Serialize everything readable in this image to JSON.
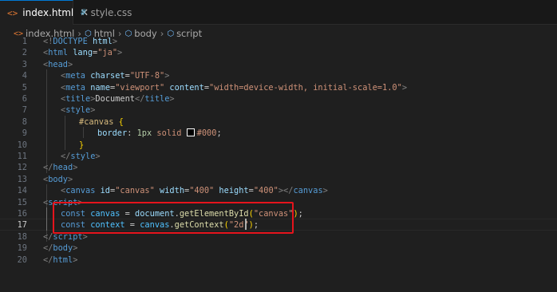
{
  "tabs": [
    {
      "icon": "<>",
      "label": "index.html",
      "close": "✕"
    },
    {
      "icon": "#",
      "label": "style.css"
    }
  ],
  "breadcrumb": {
    "file": "index.html",
    "items": [
      "html",
      "body",
      "script"
    ],
    "separator": "›"
  },
  "line_numbers": [
    "1",
    "2",
    "3",
    "4",
    "5",
    "6",
    "7",
    "8",
    "9",
    "10",
    "11",
    "12",
    "13",
    "14",
    "15",
    "16",
    "17",
    "18",
    "19",
    "20"
  ],
  "code": {
    "l1": {
      "p1": "<!",
      "tag": "DOCTYPE",
      "attr": " html",
      "p2": ">"
    },
    "l2": {
      "p1": "<",
      "tag": "html",
      "attr": " lang",
      "eq": "=",
      "val": "\"ja\"",
      "p2": ">"
    },
    "l3": {
      "p1": "<",
      "tag": "head",
      "p2": ">"
    },
    "l4": {
      "p1": "<",
      "tag": "meta",
      "attr": " charset",
      "eq": "=",
      "val": "\"UTF-8\"",
      "p2": ">"
    },
    "l5": {
      "p1": "<",
      "tag": "meta",
      "attr1": " name",
      "eq1": "=",
      "val1": "\"viewport\"",
      "attr2": " content",
      "eq2": "=",
      "val2": "\"width=device-width, initial-scale=1.0\"",
      "p2": ">"
    },
    "l6": {
      "p1": "<",
      "tag": "title",
      "p2": ">",
      "text": "Document",
      "p3": "</",
      "tag2": "title",
      "p4": ">"
    },
    "l7": {
      "p1": "<",
      "tag": "style",
      "p2": ">"
    },
    "l8": {
      "sel": "#canvas",
      "brace": " {"
    },
    "l9": {
      "prop": "border",
      "colon": ": ",
      "num": "1px",
      "rest": " solid ",
      "color": "#000",
      "semi": ";"
    },
    "l10": {
      "brace": "}"
    },
    "l11": {
      "p1": "</",
      "tag": "style",
      "p2": ">"
    },
    "l12": {
      "p1": "</",
      "tag": "head",
      "p2": ">"
    },
    "l13": {
      "p1": "<",
      "tag": "body",
      "p2": ">"
    },
    "l14": {
      "p1": "<",
      "tag": "canvas",
      "attr1": " id",
      "eq1": "=",
      "val1": "\"canvas\"",
      "attr2": " width",
      "eq2": "=",
      "val2": "\"400\"",
      "attr3": " height",
      "eq3": "=",
      "val3": "\"400\"",
      "p2": "></",
      "tag2": "canvas",
      "p3": ">"
    },
    "l15": {
      "p1": "<",
      "tag": "script",
      "p2": ">"
    },
    "l16": {
      "kw": "const",
      "var": " canvas",
      "op": " = ",
      "obj": "document",
      "dot": ".",
      "fn": "getElementById",
      "po": "(",
      "str": "\"canvas\"",
      "pc": ")",
      "semi": ";"
    },
    "l17": {
      "kw": "const",
      "var": " context",
      "op": " = ",
      "obj": "canvas",
      "dot": ".",
      "fn": "getContext",
      "po": "(",
      "str": "\"2d\"",
      "pc": ")",
      "semi": ";"
    },
    "l18": {
      "p1": "</",
      "tag": "script",
      "p2": ">"
    },
    "l19": {
      "p1": "</",
      "tag": "body",
      "p2": ">"
    },
    "l20": {
      "p1": "</",
      "tag": "html",
      "p2": ">"
    }
  },
  "colors": {
    "annotation_box": "#e5141c",
    "active_tab_accent": "#0078d4",
    "editor_background": "#1f1f1f"
  },
  "icons": {
    "html_file": "html-file-icon",
    "css_file": "css-file-icon",
    "symbol": "cube-symbol-icon"
  }
}
